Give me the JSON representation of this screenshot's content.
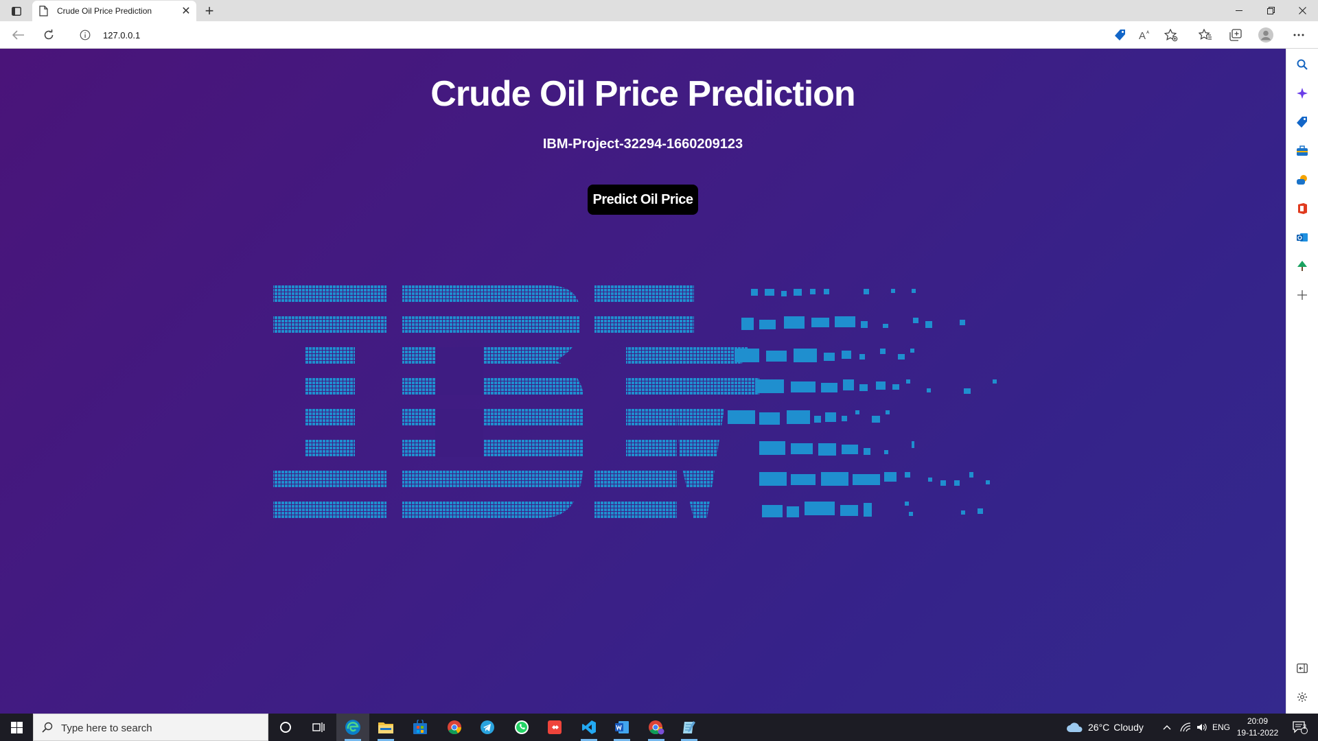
{
  "browser": {
    "tab": {
      "title": "Crude Oil Price Prediction"
    },
    "address_bar": {
      "url": "127.0.0.1"
    }
  },
  "page": {
    "title": "Crude Oil Price Prediction",
    "subtitle": "IBM-Project-32294-1660209123",
    "predict_button_label": "Predict Oil Price",
    "logo": {
      "text": "IBM",
      "color": "#1f8fcf"
    },
    "background": {
      "start": "#4a1479",
      "end": "#34298d"
    }
  },
  "taskbar": {
    "search_placeholder": "Type here to search",
    "weather": {
      "temp": "26°C",
      "condition": "Cloudy"
    },
    "language": "ENG",
    "time": "20:09",
    "date": "19-11-2022",
    "notification_count": "3"
  },
  "icons": {
    "sidebar": [
      "search-icon",
      "copilot-icon",
      "shopping-icon",
      "tools-icon",
      "games-icon",
      "office-icon",
      "outlook-icon",
      "tree-icon",
      "add-icon",
      "sidebar-toggle-icon",
      "settings-icon"
    ],
    "taskbar_apps": [
      "cortana-icon",
      "task-view-icon",
      "edge-icon",
      "file-explorer-icon",
      "store-icon",
      "chrome-icon",
      "telegram-icon",
      "whatsapp-icon",
      "anydesk-icon",
      "vscode-icon",
      "word-icon",
      "chrome-profile-icon",
      "notepad-icon"
    ]
  }
}
